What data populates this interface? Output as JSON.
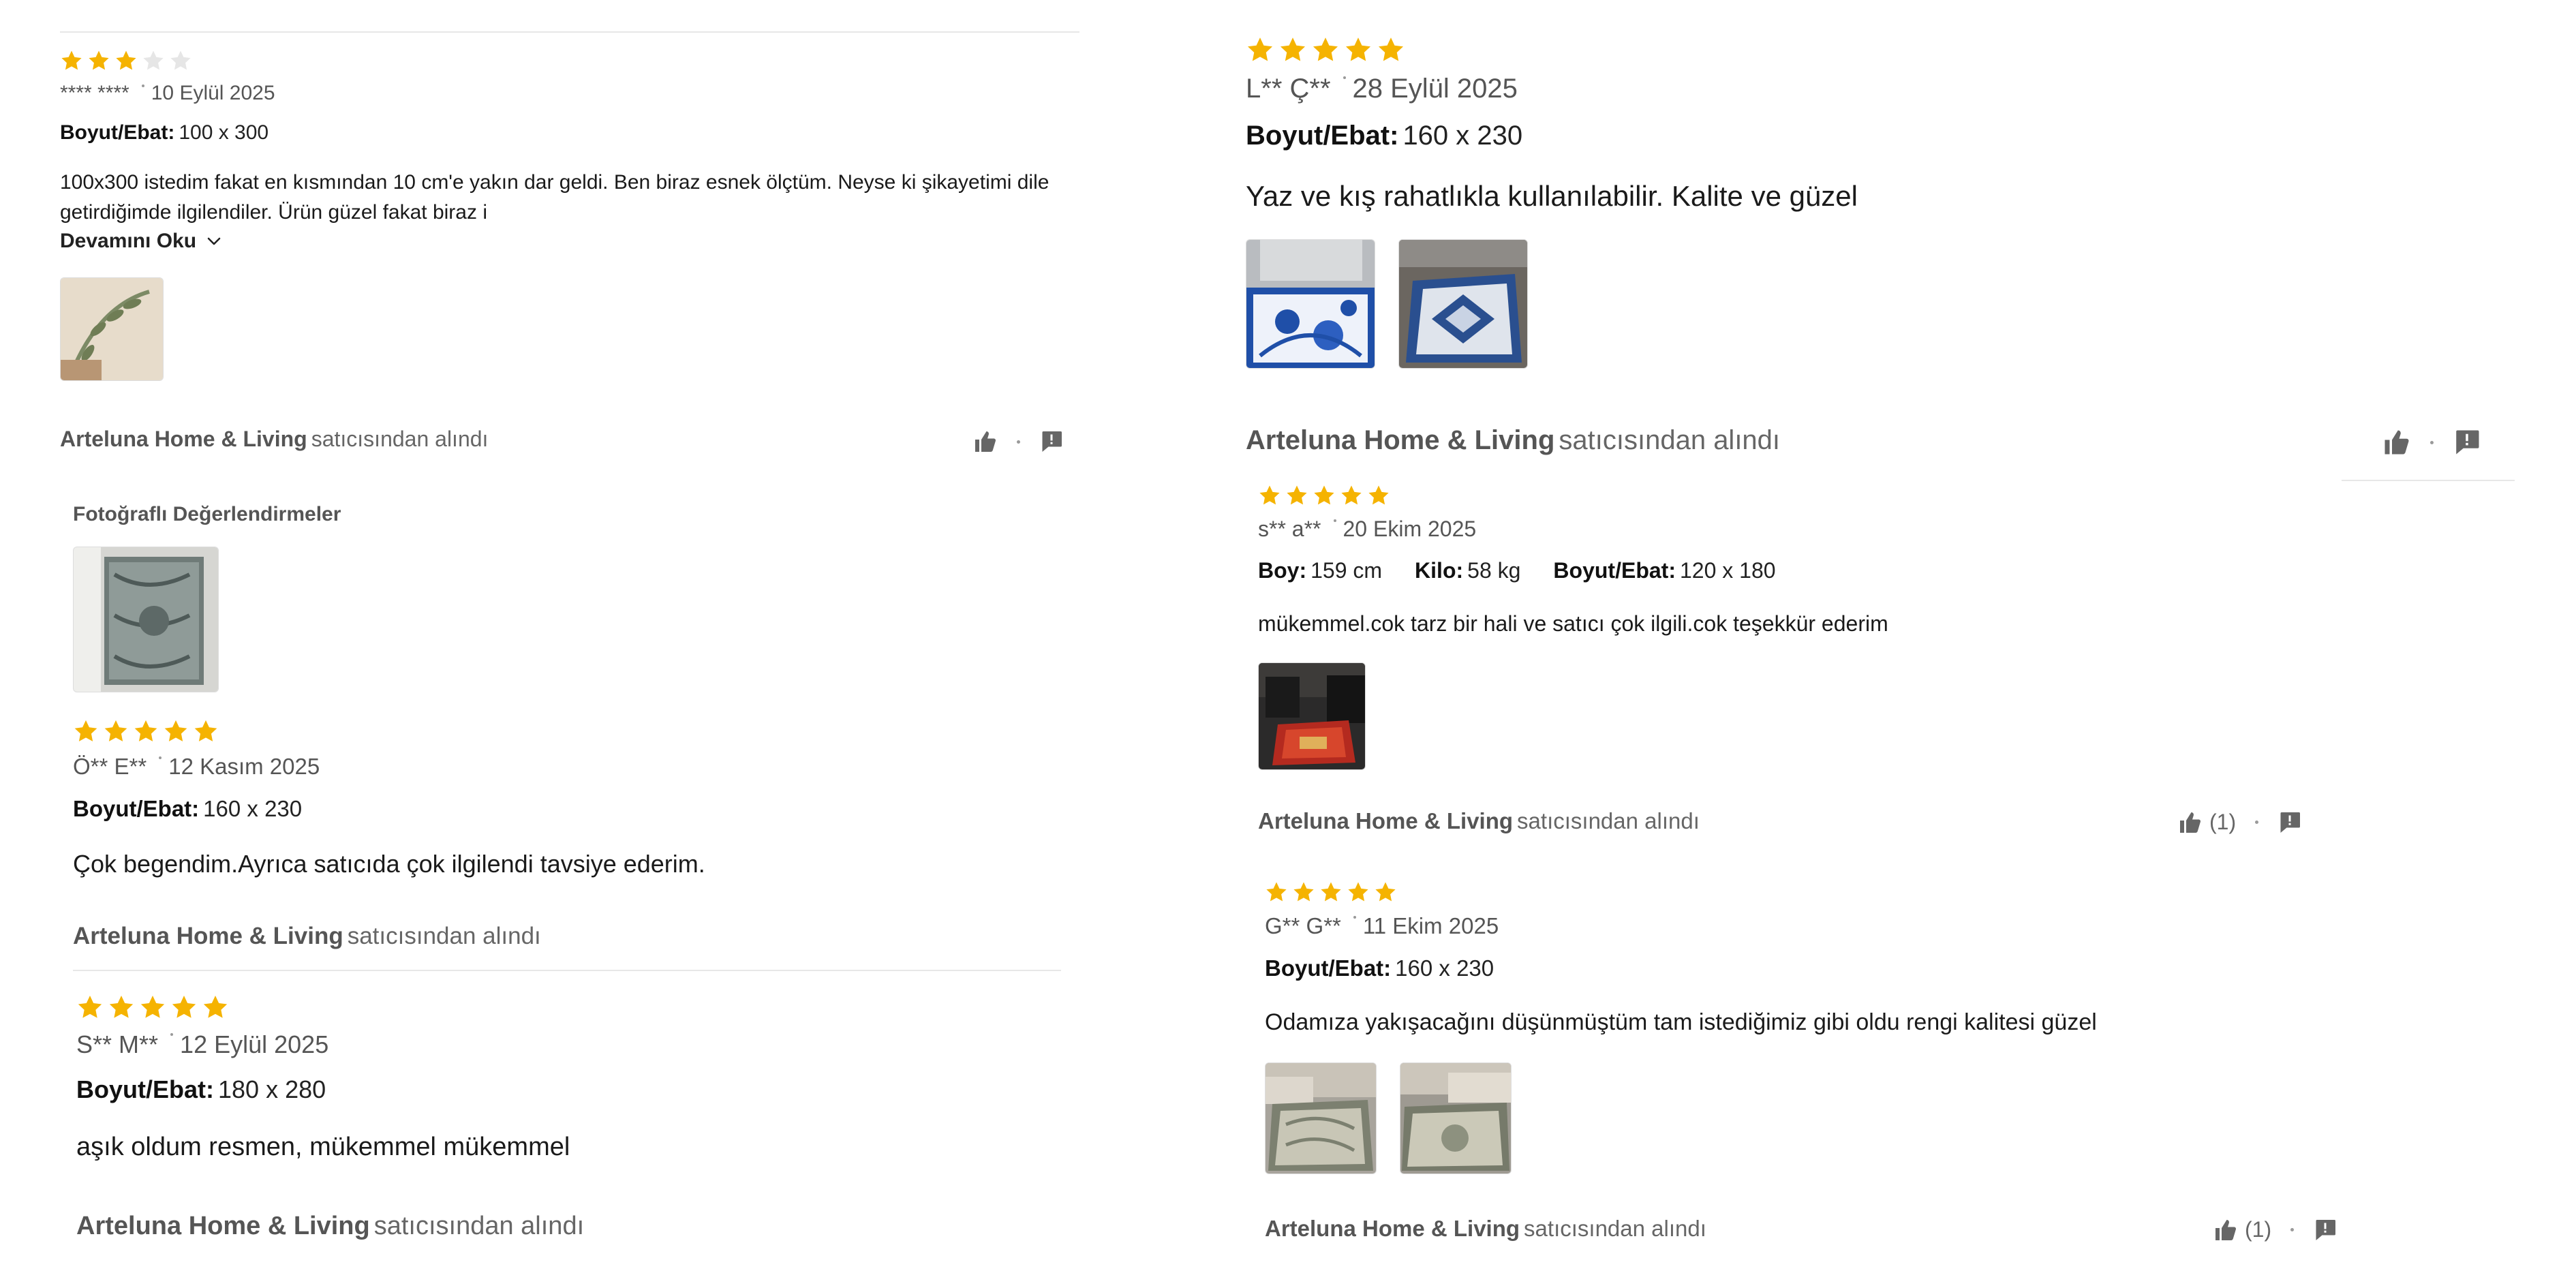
{
  "colors": {
    "star_filled": "#F5B301",
    "star_empty": "#E6E6E6",
    "text": "#1a1a1a",
    "muted": "#666666"
  },
  "seller_suffix": "satıcısından alındı",
  "left": {
    "r1": {
      "rating": 3,
      "user": "**** ****",
      "date": "10 Eylül 2025",
      "size_label": "Boyut/Ebat:",
      "size": "100 x 300",
      "text": "100x300 istedim fakat en kısmından 10 cm'e yakın dar geldi. Ben biraz esnek ölçtüm. Neyse ki şikayetimi dile getirdiğimde ilgilendiler. Ürün güzel fakat biraz i",
      "more": "Devamını Oku",
      "seller": "Arteluna Home & Living"
    },
    "photo_section_title": "Fotoğraflı Değerlendirmeler",
    "r2": {
      "rating": 5,
      "user": "Ö** E**",
      "date": "12 Kasım 2025",
      "size_label": "Boyut/Ebat:",
      "size": "160 x 230",
      "text": "Çok begendim.Ayrıca satıcıda çok ilgilendi tavsiye ederim.",
      "seller": "Arteluna Home & Living"
    },
    "r3": {
      "rating": 5,
      "user": "S** M**",
      "date": "12 Eylül 2025",
      "size_label": "Boyut/Ebat:",
      "size": "180 x 280",
      "text": "aşık oldum resmen, mükemmel mükemmel",
      "seller": "Arteluna Home & Living"
    }
  },
  "right": {
    "r1": {
      "rating": 5,
      "user": "L** Ç**",
      "date": "28 Eylül 2025",
      "size_label": "Boyut/Ebat:",
      "size": "160 x 230",
      "text": "Yaz ve kış rahatlıkla kullanılabilir. Kalite ve güzel",
      "seller": "Arteluna Home & Living"
    },
    "r2": {
      "rating": 5,
      "user": "s** a**",
      "date": "20 Ekim 2025",
      "boy_label": "Boy:",
      "boy": "159 cm",
      "kilo_label": "Kilo:",
      "kilo": "58 kg",
      "size_label": "Boyut/Ebat:",
      "size": "120 x 180",
      "text": "mükemmel.cok tarz bir hali ve satıcı çok ilgili.cok teşekkür ederim",
      "seller": "Arteluna Home & Living",
      "likes": "(1)"
    },
    "r3": {
      "rating": 5,
      "user": "G** G**",
      "date": "11 Ekim 2025",
      "size_label": "Boyut/Ebat:",
      "size": "160 x 230",
      "text": "Odamıza yakışacağını düşünmüştüm tam istediğimiz gibi oldu rengi kalitesi güzel",
      "seller": "Arteluna Home & Living",
      "likes": "(1)"
    }
  }
}
